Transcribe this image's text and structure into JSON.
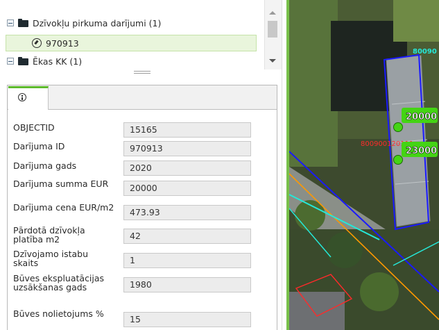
{
  "tree": {
    "items": [
      {
        "label": "Dzīvokļu pirkuma darījumi (1)",
        "icon": "folder-icon"
      },
      {
        "label": "970913",
        "icon": "compass-icon",
        "selected": true
      },
      {
        "label": "Ēkas KK (1)",
        "icon": "folder-icon"
      }
    ]
  },
  "tabs": [
    {
      "icon": "info-icon",
      "active": true
    }
  ],
  "attributes": [
    {
      "label": "OBJECTID",
      "value": "15165"
    },
    {
      "label": "Darījuma ID",
      "value": "970913"
    },
    {
      "label": "Darījuma gads",
      "value": "2020"
    },
    {
      "label": "Darījuma summa EUR",
      "value": "20000"
    },
    {
      "label": "Darījuma cena EUR/m2",
      "value": "473.93"
    },
    {
      "label": "Pārdotā dzīvokļa platība m2",
      "value": "42"
    },
    {
      "label": "Dzīvojamo istabu skaits",
      "value": "1"
    },
    {
      "label": "Būves ekspluatācijas uzsākšanas gads",
      "value": "1980"
    },
    {
      "label": "Būves nolietojums %",
      "value": "15"
    }
  ],
  "map": {
    "labels": {
      "price_a": "20000",
      "price_b": "23000",
      "parcel_red": "800900120111",
      "parcel_cyan": "80090"
    },
    "colors": {
      "accent_green": "#78c04a",
      "point_green": "#44d414",
      "building_outline": "#1a1aff",
      "road_orange": "#ff9900",
      "parcel_cyan": "#25e8d8",
      "parcel_red": "#ff2a2a"
    }
  }
}
